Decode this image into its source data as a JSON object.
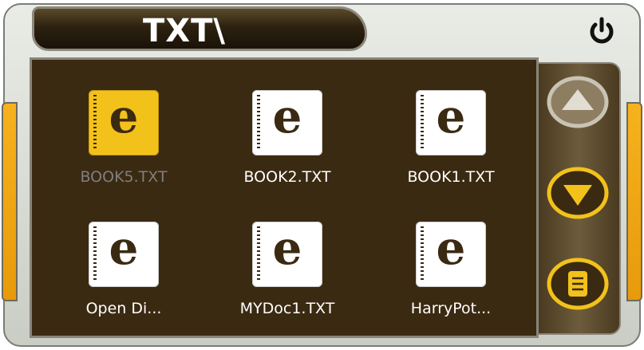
{
  "header": {
    "path_title": "TXT\\"
  },
  "files": [
    {
      "name": "BOOK5.TXT",
      "selected": true
    },
    {
      "name": "BOOK2.TXT",
      "selected": false
    },
    {
      "name": "BOOK1.TXT",
      "selected": false
    },
    {
      "name": "Open Di...",
      "selected": false
    },
    {
      "name": "MYDoc1.TXT",
      "selected": false
    },
    {
      "name": "HarryPot...",
      "selected": false
    }
  ],
  "file_icon_letter": "e",
  "icons": {
    "power": "power-icon",
    "scroll_up": "triangle-up-icon",
    "scroll_down": "triangle-down-icon",
    "menu": "list-menu-icon"
  },
  "colors": {
    "panel_background": "#3b2a12",
    "accent_yellow": "#f2c21a",
    "selected_label": "#7f7f7f",
    "label": "#ffffff"
  }
}
